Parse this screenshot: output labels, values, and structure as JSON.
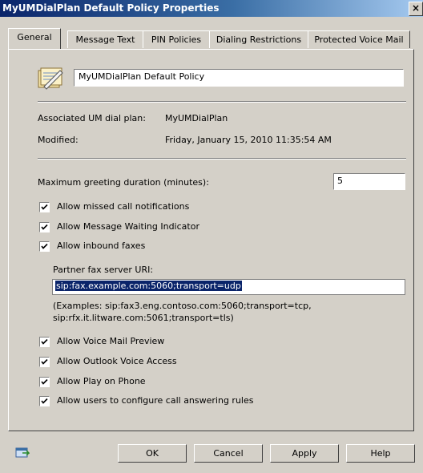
{
  "window": {
    "title": "MyUMDialPlan Default Policy Properties",
    "close_glyph": "×"
  },
  "tabs": [
    "General",
    "Message Text",
    "PIN Policies",
    "Dialing Restrictions",
    "Protected Voice Mail"
  ],
  "general": {
    "policy_name": "MyUMDialPlan Default Policy",
    "associated_label": "Associated UM dial plan:",
    "associated_value": "MyUMDialPlan",
    "modified_label": "Modified:",
    "modified_value": "Friday, January 15, 2010 11:35:54 AM",
    "greeting_label": "Maximum greeting duration (minutes):",
    "greeting_value": "5",
    "checkboxes": [
      {
        "label": "Allow missed call notifications",
        "checked": true
      },
      {
        "label": "Allow Message Waiting Indicator",
        "checked": true
      },
      {
        "label": "Allow inbound faxes",
        "checked": true
      }
    ],
    "fax_label": "Partner fax server URI:",
    "fax_value": "sip:fax.example.com:5060;transport=udp",
    "fax_example_1": "(Examples: sip:fax3.eng.contoso.com:5060;transport=tcp,",
    "fax_example_2": "sip:rfx.it.litware.com:5061;transport=tls)",
    "checkboxes2": [
      {
        "label": "Allow Voice Mail Preview",
        "checked": true
      },
      {
        "label": "Allow Outlook Voice Access",
        "checked": true
      },
      {
        "label": "Allow Play on Phone",
        "checked": true
      },
      {
        "label": "Allow users to configure call answering rules",
        "checked": true
      }
    ]
  },
  "buttons": {
    "ok": "OK",
    "cancel": "Cancel",
    "apply": "Apply",
    "help": "Help"
  }
}
